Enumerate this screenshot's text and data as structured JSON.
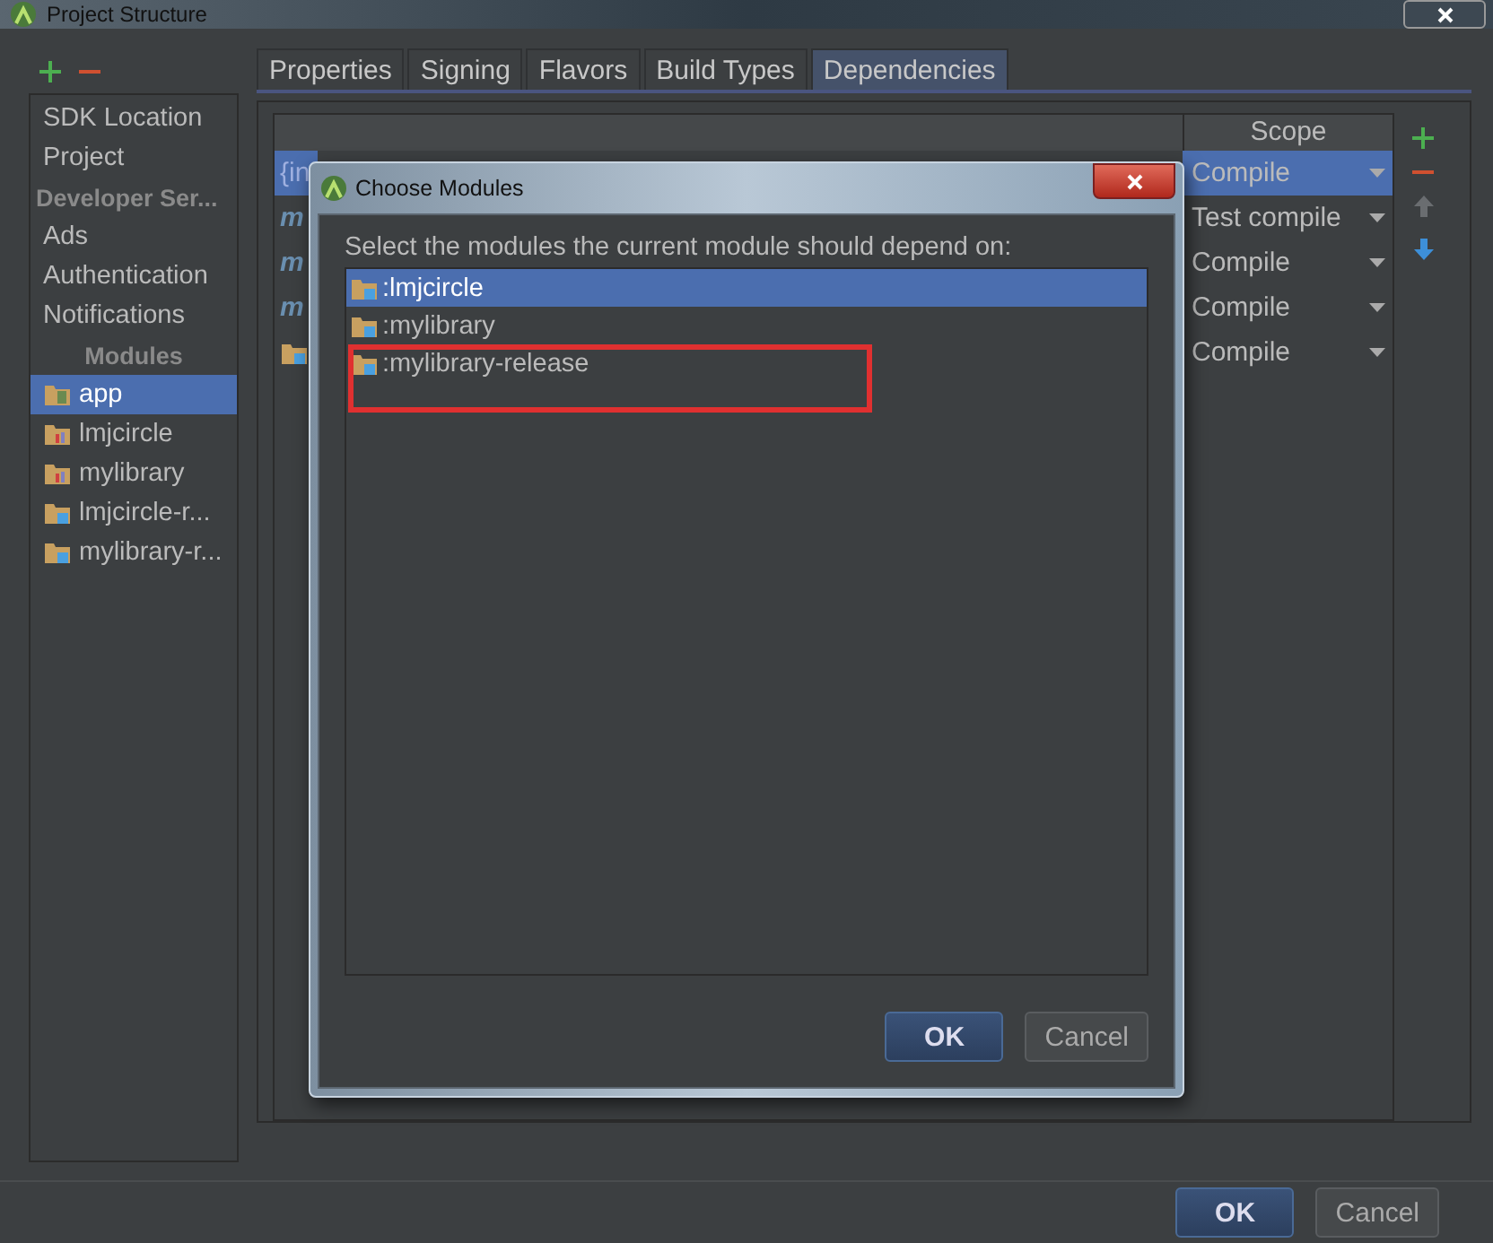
{
  "window": {
    "title": "Project Structure"
  },
  "sidebar": {
    "items": [
      {
        "label": "SDK Location",
        "kind": "item",
        "selected": false
      },
      {
        "label": "Project",
        "kind": "item",
        "selected": false
      },
      {
        "label": "Developer Ser...",
        "kind": "header",
        "selected": false
      },
      {
        "label": "Ads",
        "kind": "item",
        "selected": false
      },
      {
        "label": "Authentication",
        "kind": "item",
        "selected": false
      },
      {
        "label": "Notifications",
        "kind": "item",
        "selected": false
      },
      {
        "label": "Modules",
        "kind": "section",
        "selected": false
      },
      {
        "label": "app",
        "kind": "app",
        "selected": true
      },
      {
        "label": "lmjcircle",
        "kind": "library",
        "selected": false
      },
      {
        "label": "mylibrary",
        "kind": "library",
        "selected": false
      },
      {
        "label": "lmjcircle-r...",
        "kind": "release",
        "selected": false
      },
      {
        "label": "mylibrary-r...",
        "kind": "release",
        "selected": false
      }
    ]
  },
  "tabs": [
    {
      "label": "Properties",
      "selected": false
    },
    {
      "label": "Signing",
      "selected": false
    },
    {
      "label": "Flavors",
      "selected": false
    },
    {
      "label": "Build Types",
      "selected": false
    },
    {
      "label": "Dependencies",
      "selected": true
    }
  ],
  "dependencies": {
    "scope_header": "Scope",
    "rows": [
      {
        "text": "{in",
        "kind": "text",
        "selected": true,
        "scope": "Compile"
      },
      {
        "text": "m",
        "kind": "maven",
        "selected": false,
        "scope": "Test compile"
      },
      {
        "text": "m",
        "kind": "maven",
        "selected": false,
        "scope": "Compile"
      },
      {
        "text": "m",
        "kind": "maven",
        "selected": false,
        "scope": "Compile"
      },
      {
        "kind": "module",
        "selected": false,
        "scope": "Compile"
      }
    ]
  },
  "dialog": {
    "title": "Choose Modules",
    "prompt": "Select the modules the current module should depend on:",
    "modules": [
      {
        "label": ":lmjcircle",
        "selected": true,
        "highlighted": false
      },
      {
        "label": ":mylibrary",
        "selected": false,
        "highlighted": false
      },
      {
        "label": ":mylibrary-release",
        "selected": false,
        "highlighted": true
      }
    ],
    "buttons": [
      {
        "label": "OK",
        "kind": "primary"
      },
      {
        "label": "Cancel",
        "kind": "secondary"
      }
    ]
  },
  "buttons": [
    {
      "label": "OK",
      "kind": "primary"
    },
    {
      "label": "Cancel",
      "kind": "secondary"
    }
  ]
}
